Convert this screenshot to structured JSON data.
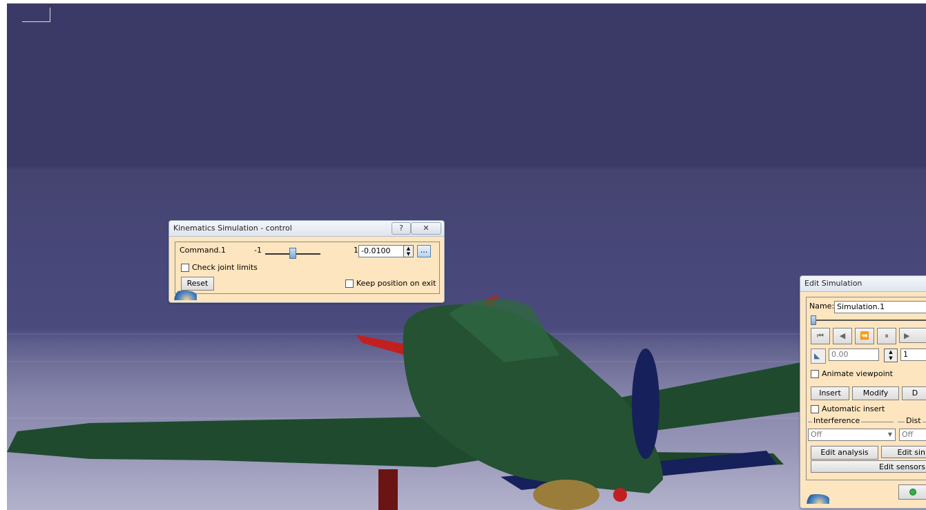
{
  "kinematics_control": {
    "title": "Kinematics Simulation - control",
    "help_icon_glyph": "?",
    "close_icon_glyph": "✕",
    "command_label": "Command.1",
    "min_label": "-1",
    "max_label": "1",
    "value": "-0.0100",
    "slider_fraction": 0.495,
    "more_button_label": "...",
    "check_joint_limits_label": "Check joint limits",
    "reset_label": "Reset",
    "keep_position_label": "Keep position on exit"
  },
  "edit_simulation": {
    "title": "Edit Simulation",
    "name_label": "Name:",
    "name_value": "Simulation.1",
    "step_value": "0.00",
    "step_count": "1",
    "animate_viewpoint_label": "Animate viewpoint",
    "insert_label": "Insert",
    "modify_label": "Modify",
    "delete_label_visible": "D",
    "automatic_insert_label": "Automatic insert",
    "interference_label": "Interference",
    "interference_value": "Off",
    "distance_label_visible": "Dist",
    "distance_value": "Off",
    "edit_analysis_label": "Edit analysis",
    "edit_sim_label_visible": "Edit sin",
    "edit_sensors_label_visible": "Edit sensors"
  },
  "colors": {
    "dialog_background": "#fde5bf",
    "plane_body": "#1f4a2e",
    "propeller": "#c22020",
    "wing_tip": "#16205a"
  }
}
